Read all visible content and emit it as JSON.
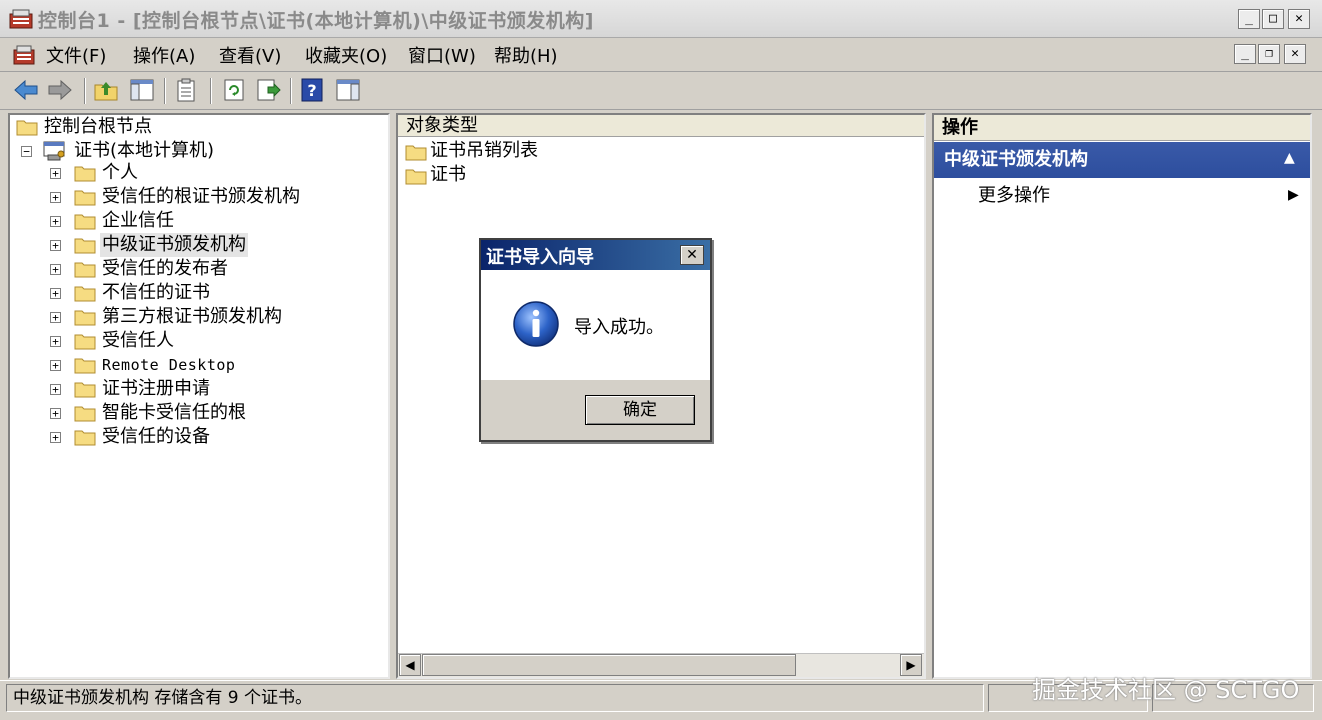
{
  "window": {
    "title": "控制台1 - [控制台根节点\\证书(本地计算机)\\中级证书颁发机构]",
    "controls": {
      "minimize": "_",
      "maximize": "□",
      "close": "✕"
    },
    "doc_controls": {
      "minimize": "_",
      "restore": "❐",
      "close": "✕"
    }
  },
  "menubar": {
    "items": [
      {
        "label": "文件(F)"
      },
      {
        "label": "操作(A)"
      },
      {
        "label": "查看(V)"
      },
      {
        "label": "收藏夹(O)"
      },
      {
        "label": "窗口(W)"
      },
      {
        "label": "帮助(H)"
      }
    ]
  },
  "toolbar": {
    "buttons": [
      "back-icon",
      "forward-icon",
      "up-folder-icon",
      "show-hide-tree-icon",
      "properties-icon",
      "refresh-icon",
      "export-list-icon",
      "help-icon",
      "show-hide-action-pane-icon"
    ]
  },
  "tree": {
    "root": "控制台根节点",
    "store": "证书(本地计算机)",
    "items": [
      {
        "label": "个人"
      },
      {
        "label": "受信任的根证书颁发机构"
      },
      {
        "label": "企业信任"
      },
      {
        "label": "中级证书颁发机构",
        "selected": true
      },
      {
        "label": "受信任的发布者"
      },
      {
        "label": "不信任的证书"
      },
      {
        "label": "第三方根证书颁发机构"
      },
      {
        "label": "受信任人"
      },
      {
        "label": "Remote Desktop"
      },
      {
        "label": "证书注册申请"
      },
      {
        "label": "智能卡受信任的根"
      },
      {
        "label": "受信任的设备"
      }
    ],
    "expander_plus": "+",
    "expander_minus": "−"
  },
  "middle": {
    "column_header": "对象类型",
    "items": [
      {
        "label": "证书吊销列表"
      },
      {
        "label": "证书"
      }
    ]
  },
  "actions": {
    "header": "操作",
    "section": "中级证书颁发机构",
    "section_toggle": "▲",
    "more": "更多操作",
    "more_arrow": "▶"
  },
  "scrollbar": {
    "left": "◀",
    "right": "▶"
  },
  "status": {
    "text": "中级证书颁发机构 存储含有 9 个证书。",
    "watermark": "掘金技术社区 @ SCTGO"
  },
  "dialog": {
    "title": "证书导入向导",
    "close": "✕",
    "message": "导入成功。",
    "ok": "确定",
    "icon": "info-icon"
  },
  "colors": {
    "chrome": "#d4d0c8",
    "dialog_title": "#0a246a",
    "action_section": "#2d4e9e"
  }
}
